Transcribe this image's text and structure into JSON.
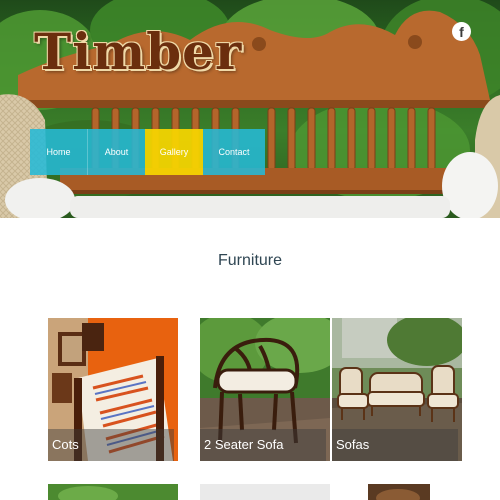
{
  "site": {
    "logo_text": "Timber"
  },
  "social": {
    "facebook_glyph": "f"
  },
  "nav": {
    "items": [
      {
        "label": "Home",
        "state": "default"
      },
      {
        "label": "About",
        "state": "default"
      },
      {
        "label": "Gallery",
        "state": "active"
      },
      {
        "label": "Contact",
        "state": "default"
      }
    ]
  },
  "colors": {
    "nav_default": "#25b9d6",
    "nav_active": "#f7d600",
    "title_text": "#2f4653"
  },
  "section": {
    "title": "Furniture"
  },
  "categories": [
    {
      "label": "Cots",
      "image": "bed-photo"
    },
    {
      "label": "2 Seater Sofa",
      "image": "two-seater-sofa-photo"
    },
    {
      "label": "Sofas",
      "image": "sofa-set-photo"
    }
  ]
}
